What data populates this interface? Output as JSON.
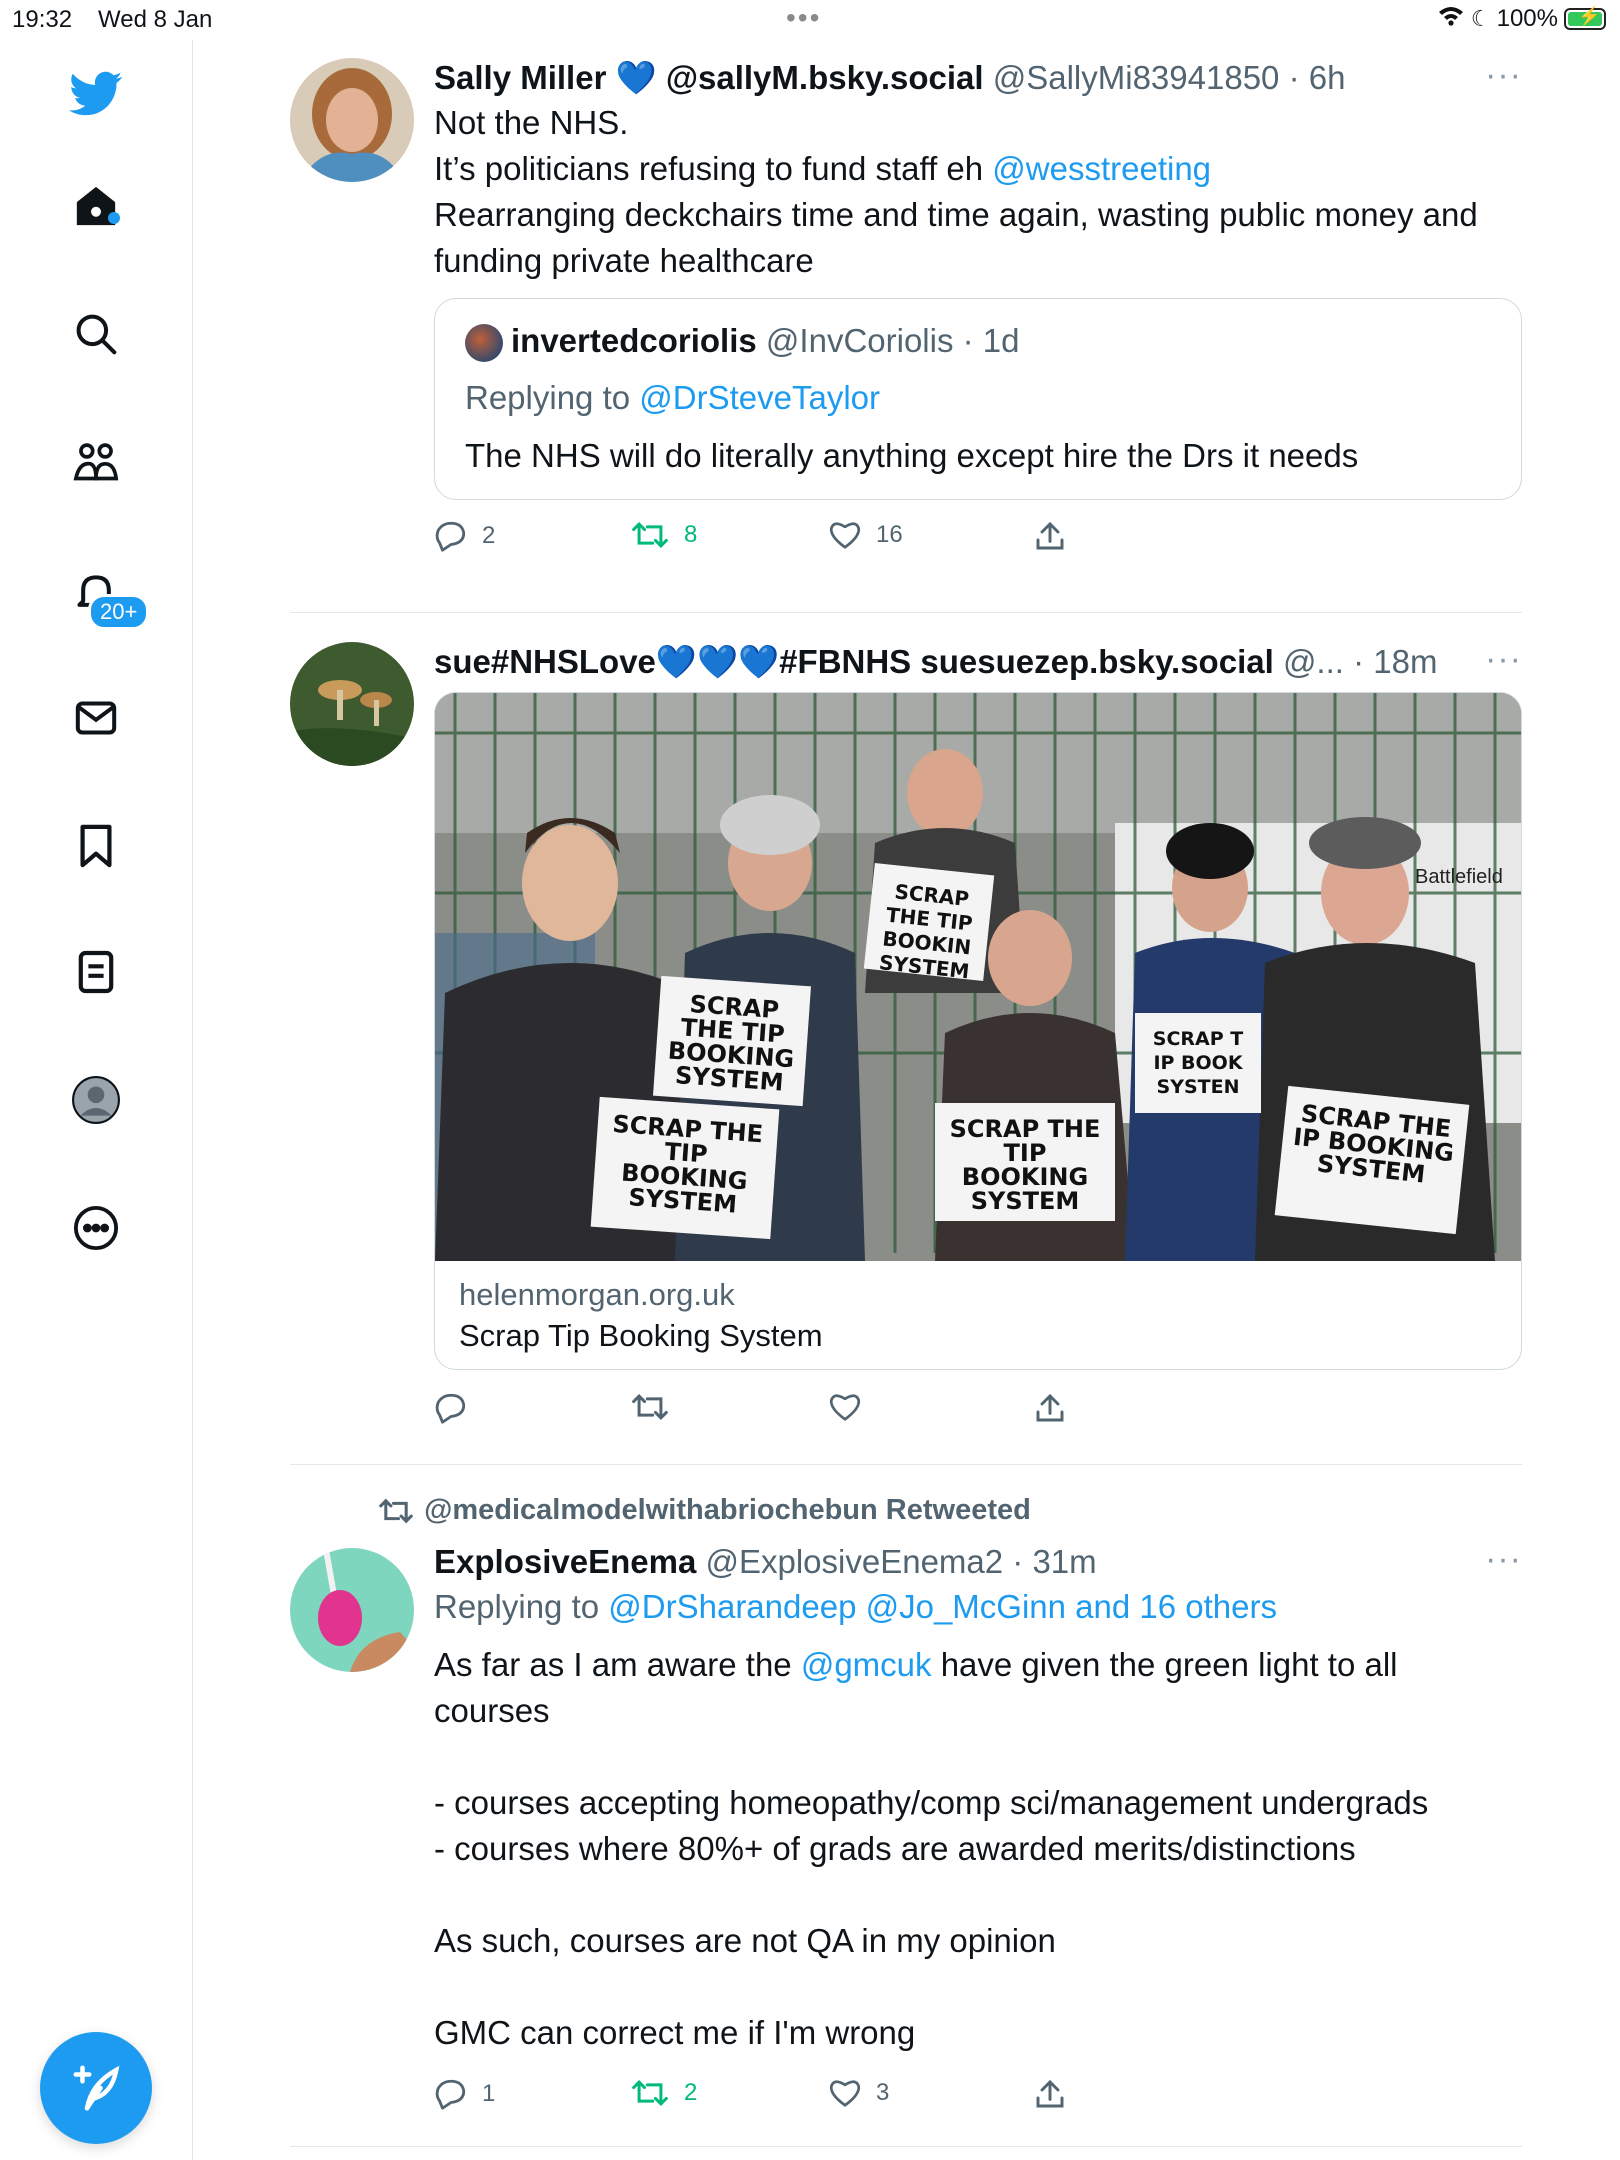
{
  "status_bar": {
    "time": "19:32",
    "date": "Wed 8 Jan",
    "battery": "100%",
    "dots": "•••"
  },
  "sidebar": {
    "notifications_badge": "20+",
    "items": [
      "twitter-logo",
      "home",
      "explore",
      "communities",
      "notifications",
      "messages",
      "bookmarks",
      "lists",
      "profile",
      "more"
    ]
  },
  "tweets": [
    {
      "name": "Sally Miller 💙 @sallyM.bsky.social",
      "handle_time": "@SallyMi83941850 · 6h",
      "more": "···",
      "lines": [
        "Not the NHS.",
        "It’s politicians refusing to fund staff eh",
        "@wesstreeting",
        "Rearranging deckchairs time and time again, wasting public money and funding private healthcare"
      ],
      "quote": {
        "name": "invertedcoriolis",
        "handle_time": "@InvCoriolis · 1d",
        "replying_prefix": "Replying to",
        "replying_to": "@DrSteveTaylor",
        "text": "The NHS will do literally anything except hire the Drs it needs"
      },
      "replies": "2",
      "retweets": "8",
      "likes": "16"
    },
    {
      "name": "sue#NHSLove💙💙💙#FBNHS suesuezep.bsky.social",
      "handle_time": "@... · 18m",
      "more": "···",
      "card": {
        "domain": "helenmorgan.org.uk",
        "title": "Scrap Tip Booking System",
        "sign_text": "SCRAP THE TIP BOOKING SYSTEM",
        "sign_partial_1": "SCRAP THE TIP BOOKIN SYSTEM",
        "sign_partial_2": "SCRAP T IP BOOK SYSTEN",
        "sign_partial_3": "SCRAP THE IP BOOKING SYSTEM",
        "background_sign": "Battlefield"
      }
    },
    {
      "retweeted_by": "@medicalmodelwithabriochebun Retweeted",
      "name": "ExplosiveEnema",
      "handle_time": "@ExplosiveEnema2 · 31m",
      "more": "···",
      "replying_prefix": "Replying to",
      "replying_to": "@DrSharandeep @Jo_McGinn and 16 others",
      "text_a": "As far as I am aware the",
      "mention": "@gmcuk",
      "text_b": "have given the green light to all courses",
      "bullet_1": "- courses accepting homeopathy/comp sci/management undergrads",
      "bullet_2": "- courses where 80%+ of grads are awarded merits/distinctions",
      "para_2": "As such, courses are not QA in my opinion",
      "para_3": "GMC can correct me if I'm wrong",
      "replies": "1",
      "retweets": "2",
      "likes": "3"
    }
  ],
  "colors": {
    "accent": "#1d9bf0",
    "retweet_green": "#00ba7c",
    "muted": "#536471"
  }
}
